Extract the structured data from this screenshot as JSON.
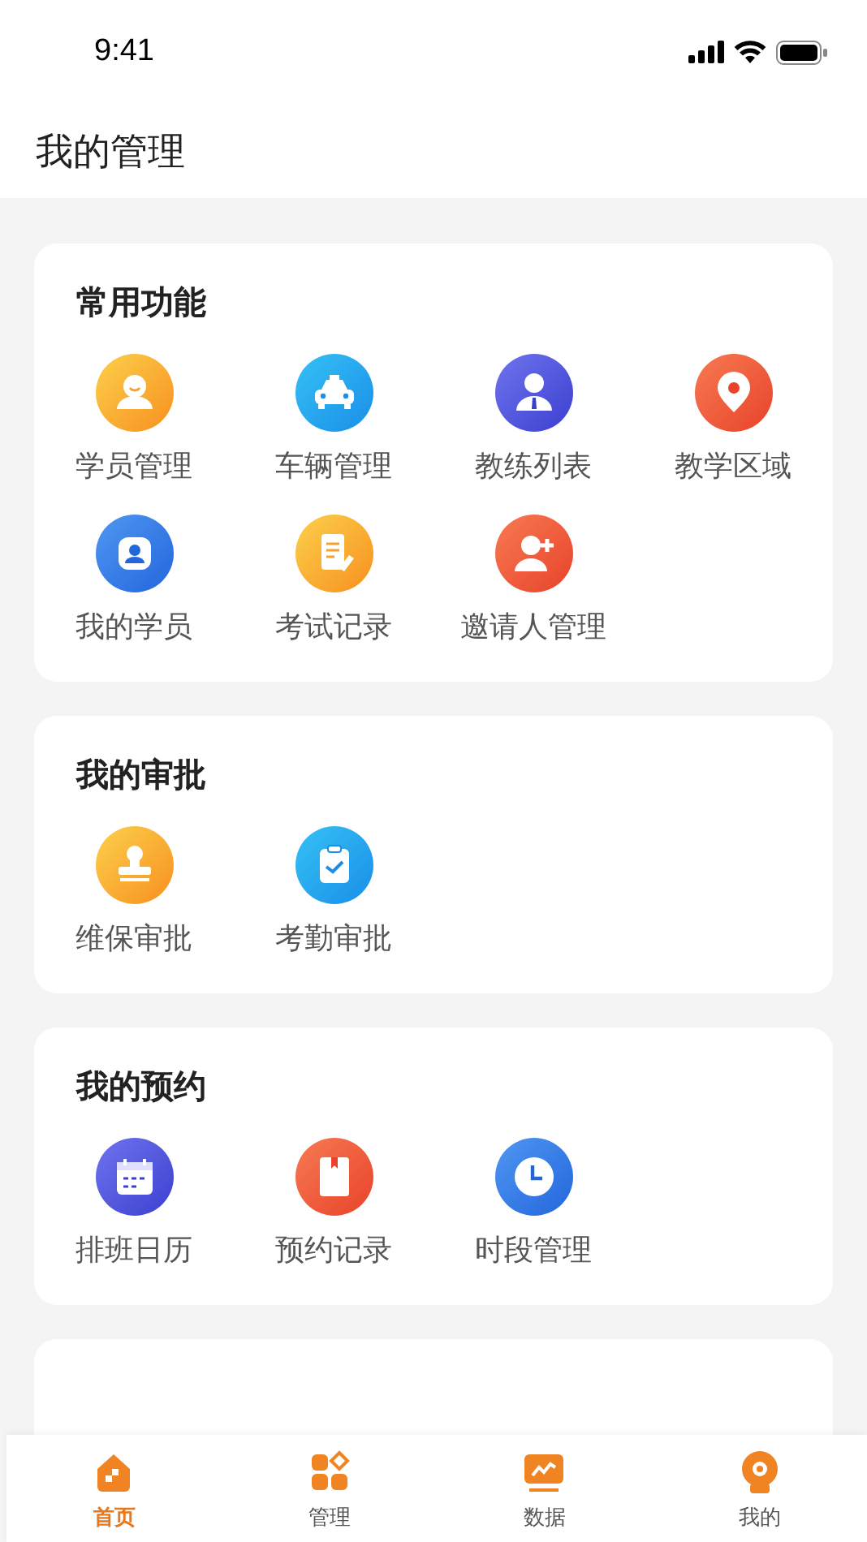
{
  "status_bar": {
    "time": "9:41"
  },
  "header": {
    "title": "我的管理"
  },
  "sections": [
    {
      "title": "常用功能",
      "items": [
        {
          "label": "学员管理",
          "kind": "student"
        },
        {
          "label": "车辆管理",
          "kind": "car"
        },
        {
          "label": "教练列表",
          "kind": "coach"
        },
        {
          "label": "教学区域",
          "kind": "pin"
        },
        {
          "label": "我的学员",
          "kind": "profile"
        },
        {
          "label": "考试记录",
          "kind": "exam"
        },
        {
          "label": "邀请人管理",
          "kind": "invite"
        }
      ]
    },
    {
      "title": "我的审批",
      "items": [
        {
          "label": "维保审批",
          "kind": "stamp"
        },
        {
          "label": "考勤审批",
          "kind": "clipboard"
        }
      ]
    },
    {
      "title": "我的预约",
      "items": [
        {
          "label": "排班日历",
          "kind": "calendar"
        },
        {
          "label": "预约记录",
          "kind": "book"
        },
        {
          "label": "时段管理",
          "kind": "clock"
        }
      ]
    }
  ],
  "tab_bar": [
    {
      "label": "首页",
      "kind": "home",
      "selected": true
    },
    {
      "label": "管理",
      "kind": "apps",
      "selected": false
    },
    {
      "label": "数据",
      "kind": "chart",
      "selected": false
    },
    {
      "label": "我的",
      "kind": "me",
      "selected": false
    }
  ]
}
